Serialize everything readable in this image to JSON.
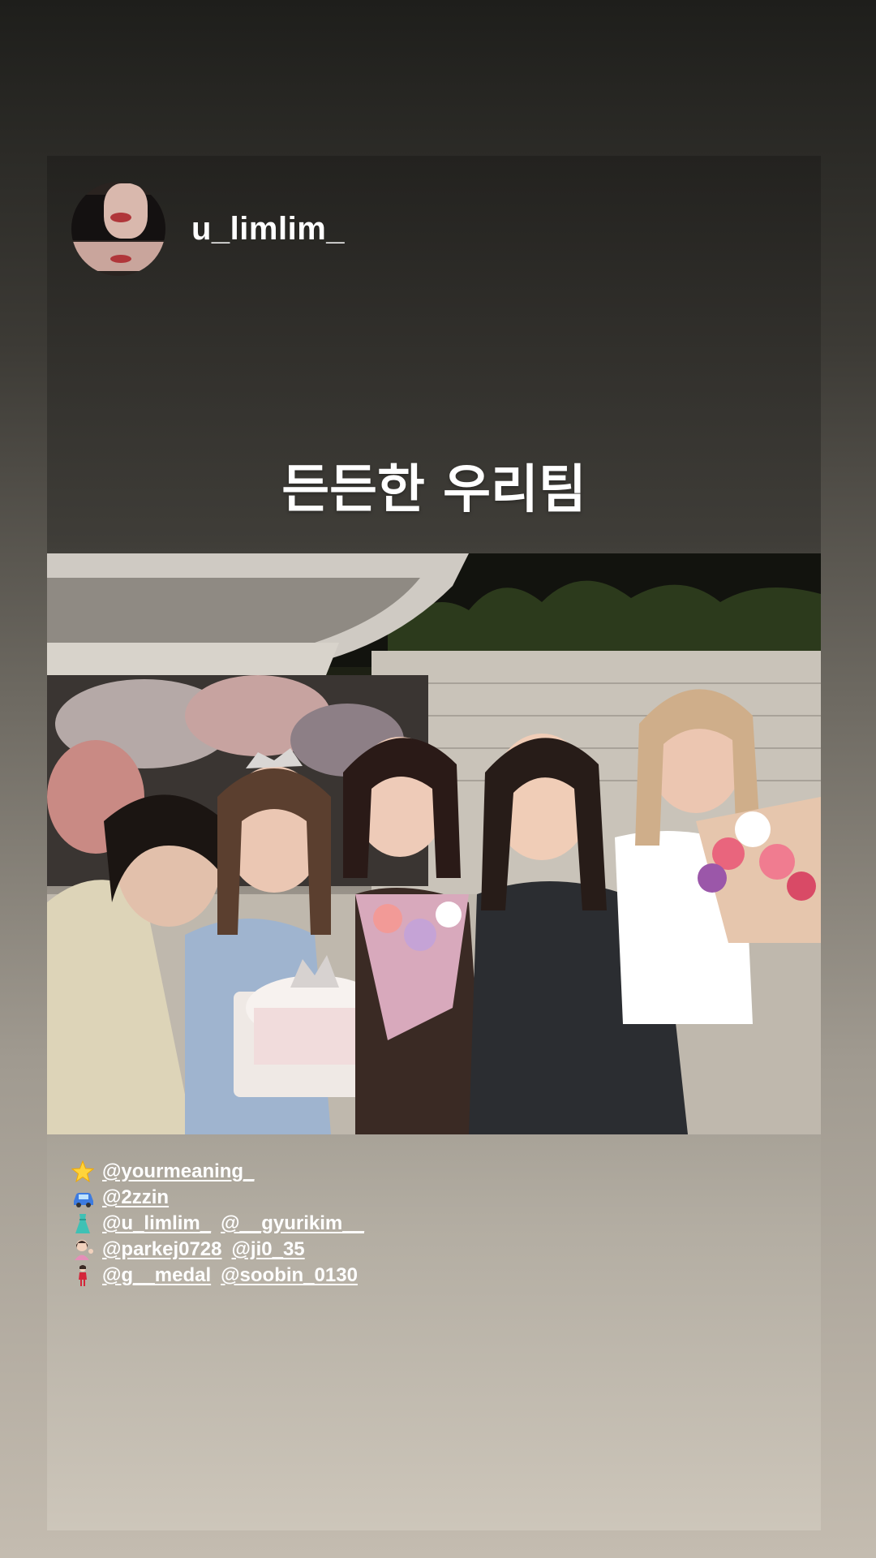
{
  "story": {
    "username": "u_limlim_",
    "caption": "든든한 우리팀",
    "photo_description_icon": "group-photo-image"
  },
  "tags": [
    {
      "emoji": "star-icon",
      "handles": [
        "@yourmeaning_"
      ]
    },
    {
      "emoji": "car-icon",
      "handles": [
        "@2zzin"
      ]
    },
    {
      "emoji": "dress-icon",
      "handles": [
        "@u_limlim_",
        "@__gyurikim__"
      ]
    },
    {
      "emoji": "woman-tipping-hand-icon",
      "handles": [
        "@parkej0728",
        "@ji0_35"
      ]
    },
    {
      "emoji": "woman-standing-icon",
      "handles": [
        "@g__medal",
        "@soobin_0130"
      ]
    }
  ]
}
